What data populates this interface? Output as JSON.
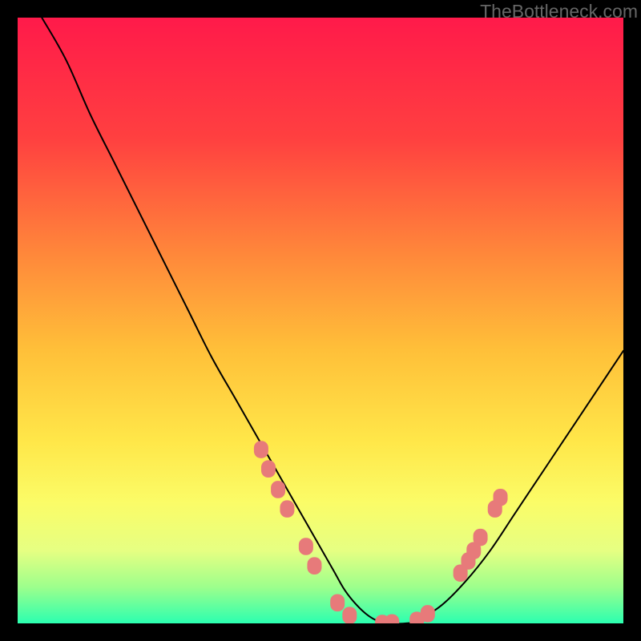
{
  "watermark": "TheBottleneck.com",
  "chart_data": {
    "type": "line",
    "title": "",
    "xlabel": "",
    "ylabel": "",
    "xlim": [
      0,
      100
    ],
    "ylim": [
      0,
      100
    ],
    "background_gradient": {
      "stops": [
        {
          "offset": 0.0,
          "color": "#ff1a4a"
        },
        {
          "offset": 0.2,
          "color": "#ff4040"
        },
        {
          "offset": 0.4,
          "color": "#ff8b3a"
        },
        {
          "offset": 0.55,
          "color": "#ffc039"
        },
        {
          "offset": 0.7,
          "color": "#ffe749"
        },
        {
          "offset": 0.8,
          "color": "#fbfc67"
        },
        {
          "offset": 0.88,
          "color": "#e6ff82"
        },
        {
          "offset": 0.94,
          "color": "#9DFF8C"
        },
        {
          "offset": 1.0,
          "color": "#2bffb0"
        }
      ]
    },
    "curve": {
      "description": "V-shaped bottleneck curve with minimum near x≈55-65; flat bottom at y≈0 then rising right side reaching y≈45 at x=100; left side starts at y≈100 at x≈5.",
      "x": [
        4,
        8,
        12,
        16,
        20,
        24,
        28,
        32,
        36,
        40,
        44,
        48,
        52,
        54,
        56,
        58,
        60,
        62,
        64,
        66,
        70,
        74,
        78,
        82,
        86,
        90,
        94,
        98,
        100
      ],
      "y": [
        100,
        93,
        84,
        76,
        68,
        60,
        52,
        44,
        37,
        30,
        23,
        16,
        9,
        5.5,
        3,
        1.2,
        0.2,
        0,
        0,
        0.5,
        3,
        7,
        12,
        18,
        24,
        30,
        36,
        42,
        45
      ]
    },
    "markers": {
      "color": "#e77a7a",
      "radius": 9,
      "points": [
        {
          "x": 40.2,
          "y": 28.7
        },
        {
          "x": 41.4,
          "y": 25.5
        },
        {
          "x": 43.0,
          "y": 22.1
        },
        {
          "x": 44.5,
          "y": 18.9
        },
        {
          "x": 47.6,
          "y": 12.7
        },
        {
          "x": 49.0,
          "y": 9.5
        },
        {
          "x": 52.8,
          "y": 3.4
        },
        {
          "x": 54.8,
          "y": 1.3
        },
        {
          "x": 60.2,
          "y": 0.0
        },
        {
          "x": 61.8,
          "y": 0.1
        },
        {
          "x": 65.9,
          "y": 0.5
        },
        {
          "x": 67.7,
          "y": 1.6
        },
        {
          "x": 73.1,
          "y": 8.3
        },
        {
          "x": 74.4,
          "y": 10.3
        },
        {
          "x": 75.3,
          "y": 12.0
        },
        {
          "x": 76.4,
          "y": 14.2
        },
        {
          "x": 78.8,
          "y": 18.9
        },
        {
          "x": 79.7,
          "y": 20.8
        }
      ]
    }
  }
}
